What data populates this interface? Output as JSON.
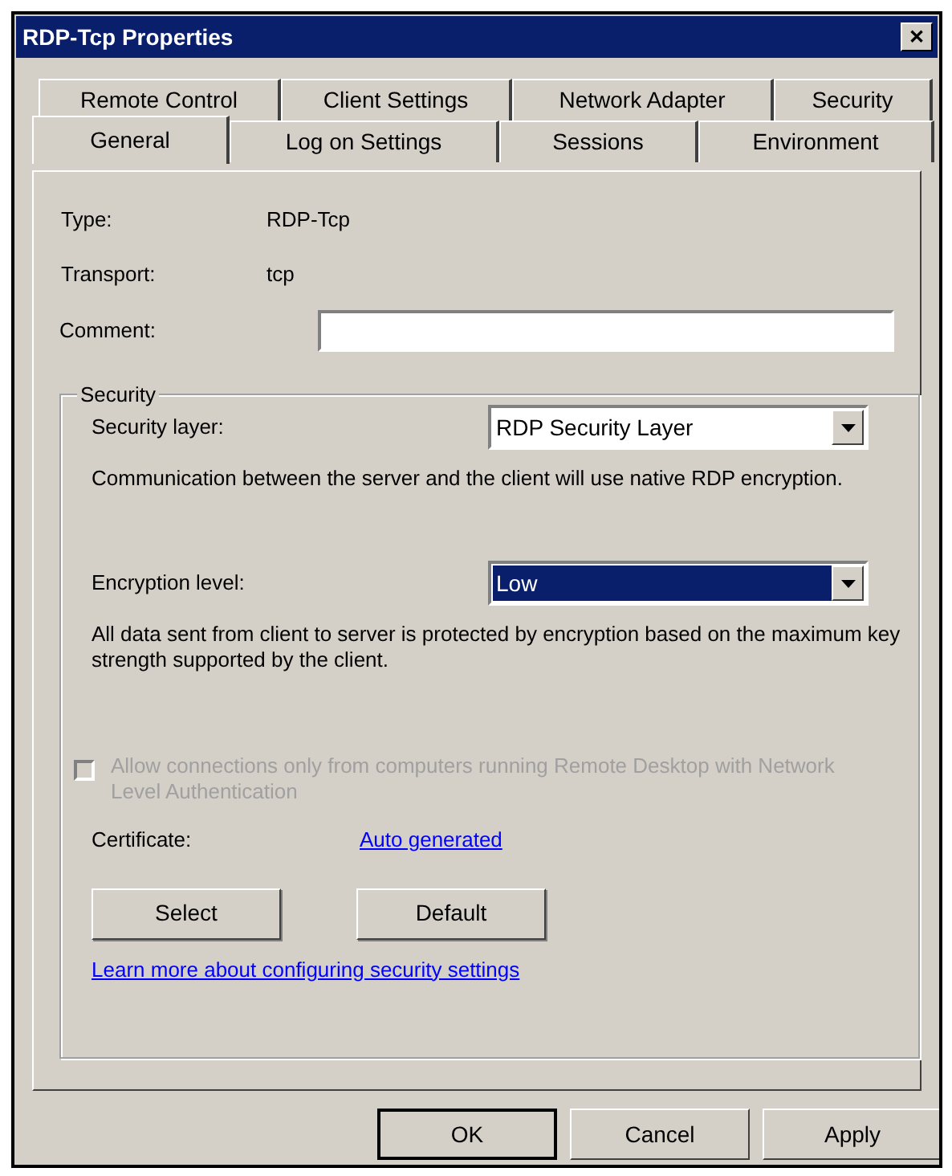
{
  "window": {
    "title": "RDP-Tcp Properties",
    "close": "✕"
  },
  "tabs_back_row": [
    {
      "label": "Remote Control",
      "selected": false
    },
    {
      "label": "Client Settings",
      "selected": false
    },
    {
      "label": "Network Adapter",
      "selected": false
    },
    {
      "label": "Security",
      "selected": false
    }
  ],
  "tabs_front_row": [
    {
      "label": "General",
      "selected": true
    },
    {
      "label": "Log on Settings",
      "selected": false
    },
    {
      "label": "Sessions",
      "selected": false
    },
    {
      "label": "Environment",
      "selected": false
    }
  ],
  "info": [
    {
      "label": "Type:",
      "value": "RDP-Tcp"
    },
    {
      "label": "Transport:",
      "value": "tcp"
    }
  ],
  "comment": {
    "label": "Comment:"
  },
  "security": {
    "title": "Security",
    "security_layer": {
      "label": "Security layer:",
      "value": "RDP Security Layer",
      "focused": false
    },
    "layer_description": "Communication between the server and the client will use native RDP encryption.",
    "encryption_level": {
      "label": "Encryption level:",
      "value": "Low",
      "focused": true
    },
    "encryption_description": "All data sent from client to server is protected by encryption based on the maximum key strength supported by the client.",
    "nla_checkbox": {
      "label": "Allow connections only from computers running Remote Desktop with Network Level Authentication",
      "checked": false,
      "disabled": true
    },
    "certificate": {
      "label": "Certificate:",
      "link": "Auto generated"
    },
    "buttons": [
      "Select",
      "Default"
    ],
    "learn_more_link": "Learn more about configuring security settings"
  },
  "dialog_buttons": [
    {
      "label": "OK",
      "default": true
    },
    {
      "label": "Cancel",
      "default": false
    },
    {
      "label": "Apply",
      "default": false
    }
  ]
}
